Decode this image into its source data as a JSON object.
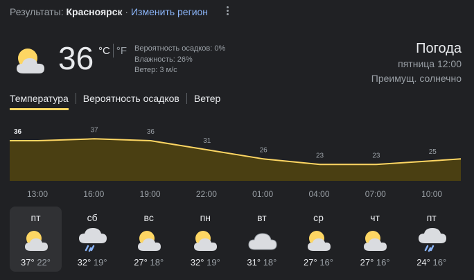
{
  "header": {
    "results_label": "Результаты:",
    "city": "Красноярск",
    "separator": "·",
    "change_region": "Изменить регион"
  },
  "current": {
    "temperature": "36",
    "unit_c": "°C",
    "unit_f": "°F",
    "precipitation": "Вероятность осадков: 0%",
    "humidity": "Влажность: 26%",
    "wind": "Ветер: 3 м/с",
    "icon": "partly-cloudy-icon"
  },
  "summary": {
    "title": "Погода",
    "datetime": "пятница 12:00",
    "condition": "Преимущ. солнечно"
  },
  "tabs": [
    "Температура",
    "Вероятность осадков",
    "Ветер"
  ],
  "chart_data": {
    "type": "area",
    "x": [
      "13:00",
      "16:00",
      "19:00",
      "22:00",
      "01:00",
      "04:00",
      "07:00",
      "10:00"
    ],
    "labels": [
      "36",
      "37",
      "36",
      "31",
      "26",
      "23",
      "23",
      "25"
    ],
    "values": [
      36,
      37,
      36,
      31,
      26,
      23,
      23,
      25
    ],
    "colors": {
      "line": "#fdd663",
      "fill": "#4a3f12"
    }
  },
  "days": [
    {
      "name": "пт",
      "hi": "37°",
      "lo": "22°",
      "icon": "partly-cloudy-icon"
    },
    {
      "name": "сб",
      "hi": "32°",
      "lo": "19°",
      "icon": "rain-icon"
    },
    {
      "name": "вс",
      "hi": "27°",
      "lo": "18°",
      "icon": "partly-cloudy-icon"
    },
    {
      "name": "пн",
      "hi": "32°",
      "lo": "19°",
      "icon": "partly-cloudy-icon"
    },
    {
      "name": "вт",
      "hi": "31°",
      "lo": "18°",
      "icon": "cloudy-icon"
    },
    {
      "name": "ср",
      "hi": "27°",
      "lo": "16°",
      "icon": "partly-cloudy-icon"
    },
    {
      "name": "чт",
      "hi": "27°",
      "lo": "16°",
      "icon": "partly-cloudy-icon"
    },
    {
      "name": "пт",
      "hi": "24°",
      "lo": "16°",
      "icon": "rain-icon"
    }
  ]
}
